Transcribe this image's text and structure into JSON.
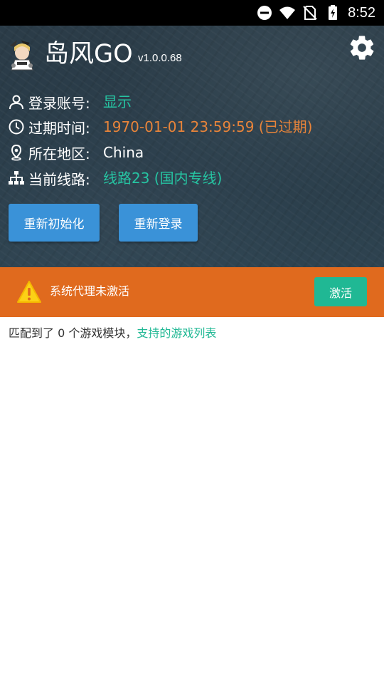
{
  "status_bar": {
    "time": "8:52",
    "icons": [
      "do-not-disturb-icon",
      "wifi-icon",
      "no-sim-icon",
      "battery-charging-icon"
    ]
  },
  "header": {
    "app_title": "岛风GO",
    "version": "v1.0.0.68",
    "logo_icon": "anime-character-logo",
    "settings_icon": "gear-icon"
  },
  "info": {
    "account_label": "登录账号:",
    "account_value": "显示",
    "expiry_label": "过期时间:",
    "expiry_value": "1970-01-01 23:59:59 (已过期)",
    "region_label": "所在地区:",
    "region_value": "China",
    "route_label": "当前线路:",
    "route_value": "线路23 (国内专线)"
  },
  "buttons": {
    "reinit": "重新初始化",
    "relogin": "重新登录"
  },
  "alert": {
    "message": "系统代理未激活",
    "action": "激活",
    "icon": "warning-icon"
  },
  "match": {
    "prefix": "匹配到了 0 个游戏模块，",
    "link": "支持的游戏列表"
  },
  "colors": {
    "accent_teal": "#26c4a2",
    "expired_orange": "#e8843a",
    "button_blue": "#3a92d8",
    "alert_orange": "#e06a1e"
  }
}
